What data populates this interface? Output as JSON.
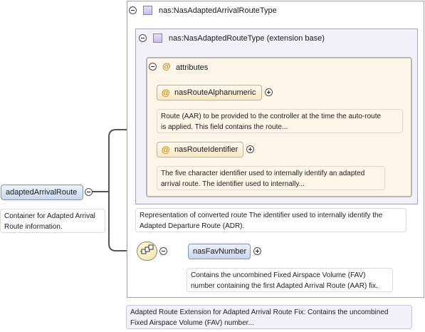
{
  "outer_type": {
    "label": "nas:NasAdaptedArrivalRouteType"
  },
  "extension": {
    "label": "nas:NasAdaptedRouteType (extension base)"
  },
  "attributes_group": {
    "label": "attributes"
  },
  "attributes": [
    {
      "name": "nasRouteAlphanumeric",
      "doc": [
        "Route (AAR) to be provided to the controller at the time the auto-route",
        "is applied. This field contains the route..."
      ]
    },
    {
      "name": "nasRouteIdentifier",
      "doc": [
        "The five character identifier used to internally identify an adapted",
        "arrival route. The identifier used to internally..."
      ]
    }
  ],
  "extension_doc": [
    "Representation of converted route The identifier used to internally identify the",
    "Adapted Departure Route (ADR)."
  ],
  "root_element": {
    "label": "adaptedArrivalRoute",
    "doc": [
      "Container for Adapted Arrival",
      "Route information."
    ]
  },
  "child_element": {
    "label": "nasFavNumber",
    "doc": [
      "Contains the uncombined Fixed Airspace Volume (FAV)",
      "number containing the first Adapted Arrival Route (AAR) fix."
    ]
  },
  "type_doc": [
    "Adapted Route Extension for Adapted Arrival Route Fix: Contains the uncombined",
    "Fixed Airspace Volume (FAV) number..."
  ]
}
